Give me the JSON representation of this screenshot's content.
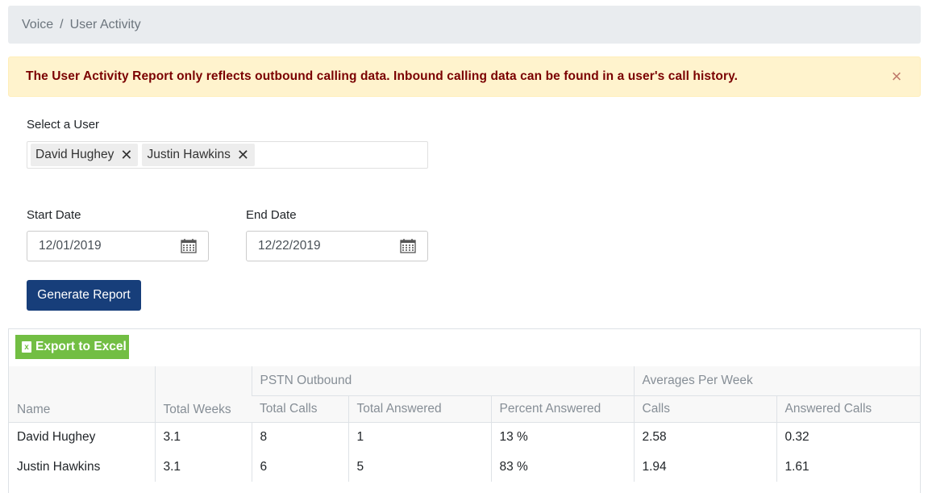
{
  "breadcrumb": {
    "items": [
      "Voice",
      "User Activity"
    ],
    "separator": "/"
  },
  "alert": {
    "text": "The User Activity Report only reflects outbound calling data. Inbound calling data can be found in a user's call history.",
    "close": "×"
  },
  "user_select": {
    "label": "Select a User",
    "selected": [
      "David Hughey",
      "Justin Hawkins"
    ],
    "remove_glyph": "✕"
  },
  "dates": {
    "start_label": "Start Date",
    "start_value": "12/01/2019",
    "end_label": "End Date",
    "end_value": "12/22/2019"
  },
  "generate_button": "Generate Report",
  "export_button": "Export to Excel",
  "table": {
    "group_headers": {
      "pstn": "PSTN Outbound",
      "averages": "Averages Per Week"
    },
    "columns": [
      "Name",
      "Total Weeks",
      "Total Calls",
      "Total Answered",
      "Percent Answered",
      "Calls",
      "Answered Calls"
    ],
    "rows": [
      [
        "David Hughey",
        "3.1",
        "8",
        "1",
        "13 %",
        "2.58",
        "0.32"
      ],
      [
        "Justin Hawkins",
        "3.1",
        "6",
        "5",
        "83 %",
        "1.94",
        "1.61"
      ]
    ]
  },
  "colors": {
    "primary_button": "#173e7a",
    "excel_button": "#72be43",
    "alert_bg": "#fff3cd",
    "alert_text": "#7a0000"
  }
}
